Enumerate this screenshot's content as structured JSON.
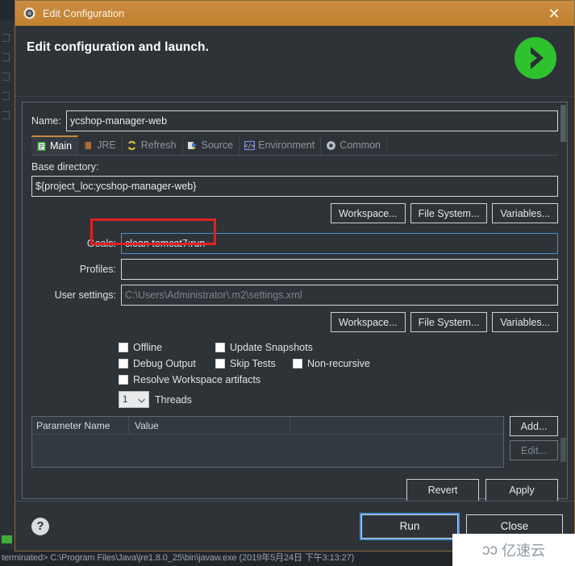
{
  "window": {
    "title": "Edit Configuration",
    "title_icon": "gear-icon",
    "close_label": "✕",
    "titlebar_color": "#c8883f"
  },
  "banner": {
    "heading": "Edit configuration and launch.",
    "icon": "green-run-arrow-icon",
    "icon_color": "#2fc22f"
  },
  "name_field": {
    "label": "Name:",
    "value": "ycshop-manager-web"
  },
  "tabs": [
    {
      "label": "Main",
      "icon": "main-tab-icon",
      "active": true
    },
    {
      "label": "JRE",
      "icon": "jre-tab-icon",
      "active": false
    },
    {
      "label": "Refresh",
      "icon": "refresh-tab-icon",
      "active": false
    },
    {
      "label": "Source",
      "icon": "source-tab-icon",
      "active": false
    },
    {
      "label": "Environment",
      "icon": "environment-tab-icon",
      "active": false
    },
    {
      "label": "Common",
      "icon": "common-tab-icon",
      "active": false
    }
  ],
  "base_directory": {
    "label": "Base directory:",
    "value": "${project_loc:ycshop-manager-web}"
  },
  "dir_buttons": [
    {
      "label": "Workspace...",
      "accel": "W"
    },
    {
      "label": "File System...",
      "accel": "m"
    },
    {
      "label": "Variables...",
      "accel": "V"
    }
  ],
  "goals": {
    "label": "Goals:",
    "value": "clean tomcat7:run",
    "highlighted": true,
    "highlight_color": "#e02020"
  },
  "profiles": {
    "label": "Profiles:",
    "value": ""
  },
  "user_settings": {
    "label": "User settings:",
    "value": "C:\\Users\\Administrator\\.m2\\settings.xml",
    "disabled": true
  },
  "settings_buttons": [
    {
      "label": "Workspace...",
      "accel": "W"
    },
    {
      "label": "File System...",
      "accel": "m"
    },
    {
      "label": "Variables...",
      "accel": "V"
    }
  ],
  "checkboxes": [
    {
      "label": "Offline",
      "accel": "ff",
      "checked": false
    },
    {
      "label": "Update Snapshots",
      "accel": "U",
      "checked": false
    },
    {
      "label": "Debug Output",
      "accel": "g",
      "checked": false
    },
    {
      "label": "Skip Tests",
      "accel": "k",
      "checked": false
    },
    {
      "label": "Non-recursive",
      "accel": "",
      "checked": false
    },
    {
      "label": "Resolve Workspace artifacts",
      "accel": "",
      "checked": false
    }
  ],
  "threads": {
    "value": "1",
    "label": "Threads"
  },
  "parameter_table": {
    "columns": [
      "Parameter Name",
      "Value"
    ],
    "rows": []
  },
  "table_buttons": [
    {
      "label": "Add...",
      "enabled": true
    },
    {
      "label": "Edit...",
      "enabled": false
    }
  ],
  "form_buttons": [
    {
      "label": "Revert",
      "accel": "v"
    },
    {
      "label": "Apply",
      "accel": ""
    }
  ],
  "footer": {
    "help_icon": "help-question-icon",
    "help_glyph": "?",
    "buttons": [
      {
        "label": "Run",
        "accel": "R",
        "primary": true
      },
      {
        "label": "Close",
        "accel": "",
        "primary": false
      }
    ]
  },
  "watermark": {
    "url": "https://blog.csdn.net/",
    "logo_text": "亿速云",
    "logo_glyph": "ɔɔ"
  },
  "background": {
    "console_line": "terminated> C:\\Program Files\\Java\\jre1.8.0_25\\bin\\javaw.exe (2019年5月24日 下午3:13:27)"
  }
}
